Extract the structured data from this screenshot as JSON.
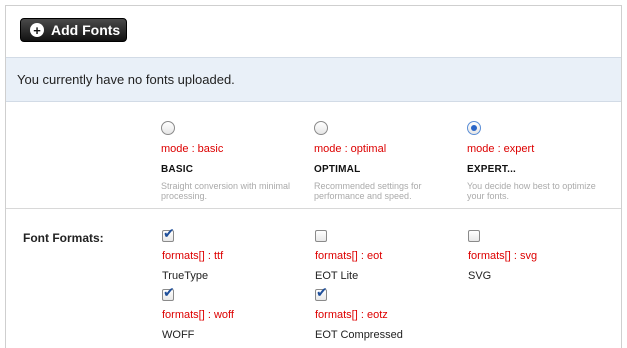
{
  "toolbar": {
    "add_fonts_label": "Add Fonts"
  },
  "notice": {
    "text": "You currently have no fonts uploaded."
  },
  "modes": [
    {
      "code": "mode : basic",
      "title": "BASIC",
      "description": "Straight conversion with minimal processing.",
      "checked": false
    },
    {
      "code": "mode : optimal",
      "title": "OPTIMAL",
      "description": "Recommended settings for performance and speed.",
      "checked": false
    },
    {
      "code": "mode : expert",
      "title": "EXPERT...",
      "description": "You decide how best to optimize your fonts.",
      "checked": true
    }
  ],
  "font_formats": {
    "label": "Font Formats:",
    "items": [
      {
        "code": "formats[] : ttf",
        "name": "TrueType",
        "checked": true
      },
      {
        "code": "formats[] : eot",
        "name": "EOT Lite",
        "checked": false
      },
      {
        "code": "formats[] : svg",
        "name": "SVG",
        "checked": false
      },
      {
        "code": "formats[] : woff",
        "name": "WOFF",
        "checked": true
      },
      {
        "code": "formats[] : eotz",
        "name": "EOT Compressed",
        "checked": true
      }
    ]
  },
  "colors": {
    "code_red": "#dd0000",
    "notice_bg": "#e9f0f8",
    "check_blue": "#1f4f9a"
  }
}
